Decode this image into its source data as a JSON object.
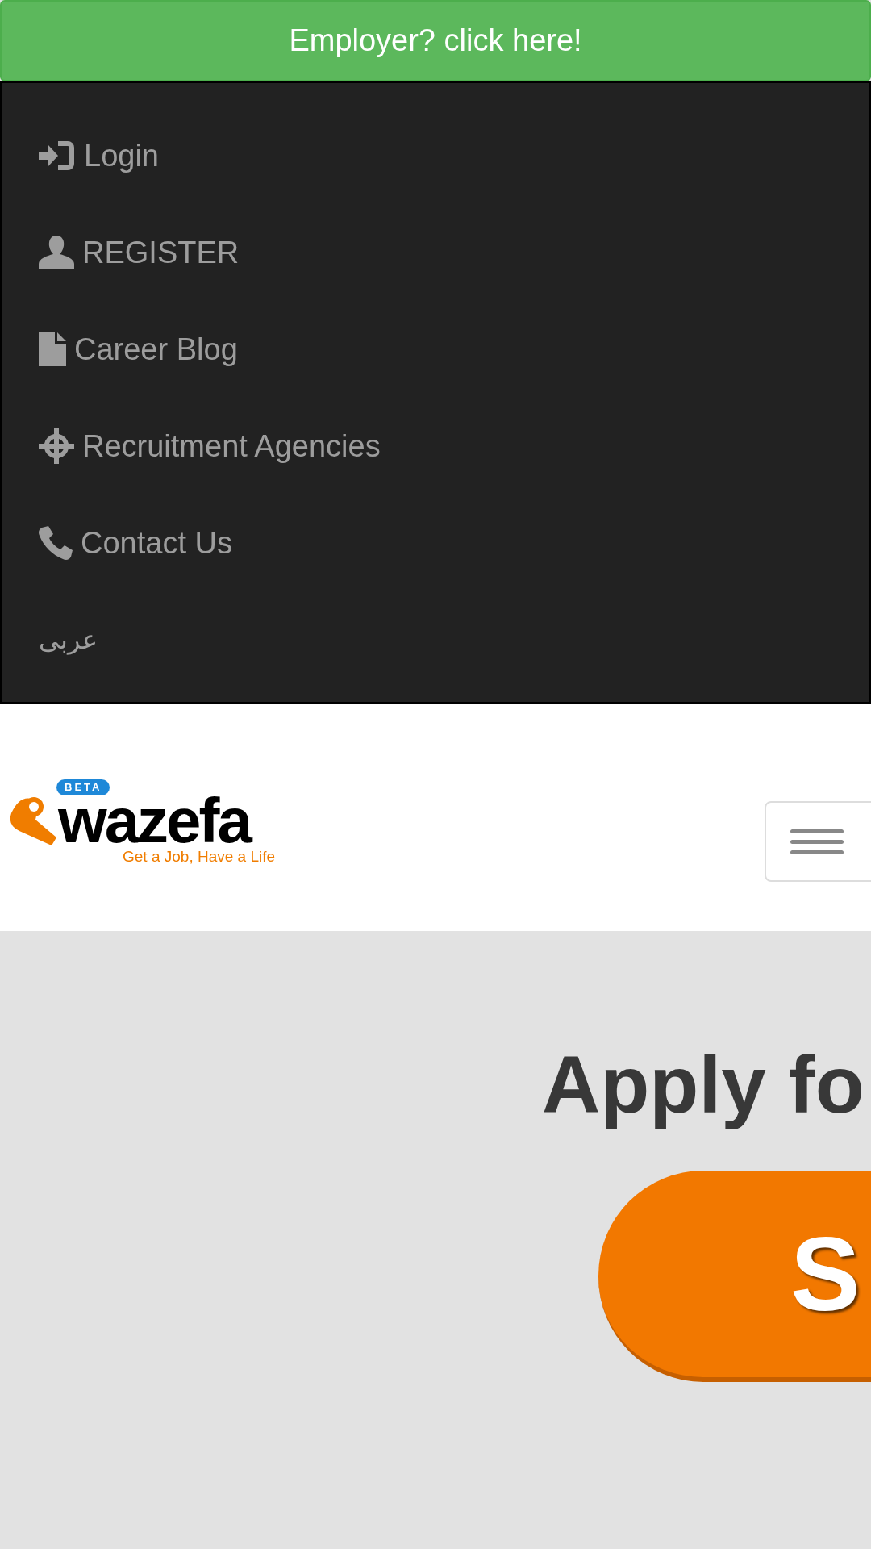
{
  "employer_banner": {
    "label": "Employer? click here!"
  },
  "menu": {
    "items": [
      {
        "kind": "login",
        "label": "Login"
      },
      {
        "kind": "user",
        "label": "REGISTER"
      },
      {
        "kind": "file",
        "label": "Career Blog"
      },
      {
        "kind": "target",
        "label": "Recruitment Agencies"
      },
      {
        "kind": "phone",
        "label": "Contact Us"
      },
      {
        "kind": "none",
        "label": "عربى"
      }
    ]
  },
  "logo": {
    "badge": "BETA",
    "name": "wazefa",
    "tagline": "Get a Job, Have a Life"
  },
  "hero": {
    "heading": "Apply fo",
    "button": "S"
  }
}
